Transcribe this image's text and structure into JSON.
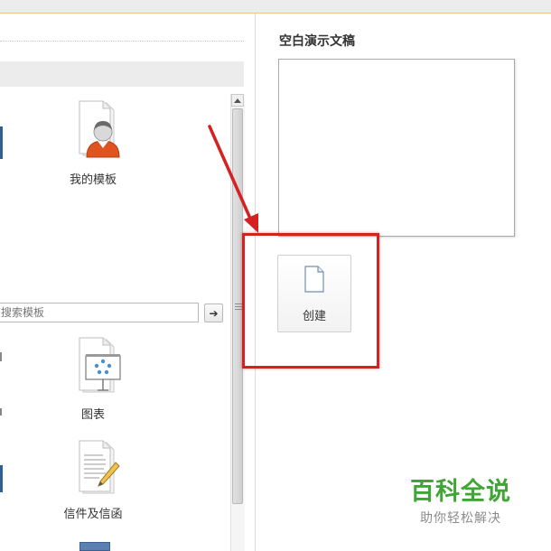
{
  "templates_pane": {
    "items": [
      {
        "label": "我的模板",
        "icon": "user-template-icon"
      },
      {
        "label": "图表",
        "icon": "chart-template-icon"
      },
      {
        "label": "信件及信函",
        "icon": "letter-template-icon"
      }
    ],
    "search": {
      "placeholder": "搜索模板",
      "value": "",
      "go_icon": "arrow-right-icon",
      "go_glyph": "➔"
    }
  },
  "preview_pane": {
    "title": "空白演示文稿",
    "create_label": "创建",
    "create_icon": "blank-document-icon"
  },
  "annotation": {
    "color": "#d42121"
  },
  "watermark": {
    "logo_text": "百科全说",
    "slogan": "助你轻松解决",
    "logo_color": "#3fa535"
  },
  "colors": {
    "highlight": "#d42121",
    "edge_accent": "#2f5e92",
    "top_border": "#f0c29a"
  }
}
